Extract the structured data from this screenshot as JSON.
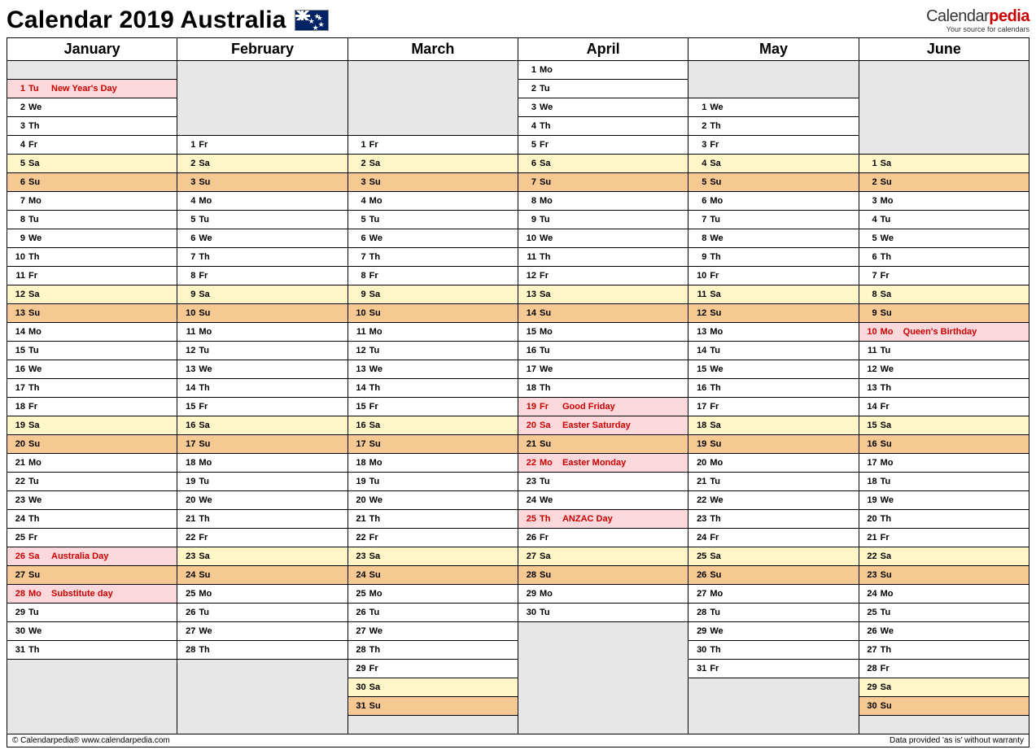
{
  "title": "Calendar 2019 Australia",
  "brand": {
    "p1": "Calendar",
    "p2": "pedia",
    "tagline": "Your source for calendars"
  },
  "footer": {
    "left": "© Calendarpedia®   www.calendarpedia.com",
    "right": "Data provided 'as is' without warranty"
  },
  "months": [
    "January",
    "February",
    "March",
    "April",
    "May",
    "June"
  ],
  "rows": 37,
  "columns": [
    {
      "offset": 1,
      "days": [
        {
          "n": 1,
          "w": "Tu",
          "h": "New Year's Day"
        },
        {
          "n": 2,
          "w": "We"
        },
        {
          "n": 3,
          "w": "Th"
        },
        {
          "n": 4,
          "w": "Fr"
        },
        {
          "n": 5,
          "w": "Sa"
        },
        {
          "n": 6,
          "w": "Su"
        },
        {
          "n": 7,
          "w": "Mo"
        },
        {
          "n": 8,
          "w": "Tu"
        },
        {
          "n": 9,
          "w": "We"
        },
        {
          "n": 10,
          "w": "Th"
        },
        {
          "n": 11,
          "w": "Fr"
        },
        {
          "n": 12,
          "w": "Sa"
        },
        {
          "n": 13,
          "w": "Su"
        },
        {
          "n": 14,
          "w": "Mo"
        },
        {
          "n": 15,
          "w": "Tu"
        },
        {
          "n": 16,
          "w": "We"
        },
        {
          "n": 17,
          "w": "Th"
        },
        {
          "n": 18,
          "w": "Fr"
        },
        {
          "n": 19,
          "w": "Sa"
        },
        {
          "n": 20,
          "w": "Su"
        },
        {
          "n": 21,
          "w": "Mo"
        },
        {
          "n": 22,
          "w": "Tu"
        },
        {
          "n": 23,
          "w": "We"
        },
        {
          "n": 24,
          "w": "Th"
        },
        {
          "n": 25,
          "w": "Fr"
        },
        {
          "n": 26,
          "w": "Sa",
          "h": "Australia Day"
        },
        {
          "n": 27,
          "w": "Su"
        },
        {
          "n": 28,
          "w": "Mo",
          "h": "Substitute day"
        },
        {
          "n": 29,
          "w": "Tu"
        },
        {
          "n": 30,
          "w": "We"
        },
        {
          "n": 31,
          "w": "Th"
        }
      ]
    },
    {
      "offset": 4,
      "days": [
        {
          "n": 1,
          "w": "Fr"
        },
        {
          "n": 2,
          "w": "Sa"
        },
        {
          "n": 3,
          "w": "Su"
        },
        {
          "n": 4,
          "w": "Mo"
        },
        {
          "n": 5,
          "w": "Tu"
        },
        {
          "n": 6,
          "w": "We"
        },
        {
          "n": 7,
          "w": "Th"
        },
        {
          "n": 8,
          "w": "Fr"
        },
        {
          "n": 9,
          "w": "Sa"
        },
        {
          "n": 10,
          "w": "Su"
        },
        {
          "n": 11,
          "w": "Mo"
        },
        {
          "n": 12,
          "w": "Tu"
        },
        {
          "n": 13,
          "w": "We"
        },
        {
          "n": 14,
          "w": "Th"
        },
        {
          "n": 15,
          "w": "Fr"
        },
        {
          "n": 16,
          "w": "Sa"
        },
        {
          "n": 17,
          "w": "Su"
        },
        {
          "n": 18,
          "w": "Mo"
        },
        {
          "n": 19,
          "w": "Tu"
        },
        {
          "n": 20,
          "w": "We"
        },
        {
          "n": 21,
          "w": "Th"
        },
        {
          "n": 22,
          "w": "Fr"
        },
        {
          "n": 23,
          "w": "Sa"
        },
        {
          "n": 24,
          "w": "Su"
        },
        {
          "n": 25,
          "w": "Mo"
        },
        {
          "n": 26,
          "w": "Tu"
        },
        {
          "n": 27,
          "w": "We"
        },
        {
          "n": 28,
          "w": "Th"
        }
      ]
    },
    {
      "offset": 4,
      "days": [
        {
          "n": 1,
          "w": "Fr"
        },
        {
          "n": 2,
          "w": "Sa"
        },
        {
          "n": 3,
          "w": "Su"
        },
        {
          "n": 4,
          "w": "Mo"
        },
        {
          "n": 5,
          "w": "Tu"
        },
        {
          "n": 6,
          "w": "We"
        },
        {
          "n": 7,
          "w": "Th"
        },
        {
          "n": 8,
          "w": "Fr"
        },
        {
          "n": 9,
          "w": "Sa"
        },
        {
          "n": 10,
          "w": "Su"
        },
        {
          "n": 11,
          "w": "Mo"
        },
        {
          "n": 12,
          "w": "Tu"
        },
        {
          "n": 13,
          "w": "We"
        },
        {
          "n": 14,
          "w": "Th"
        },
        {
          "n": 15,
          "w": "Fr"
        },
        {
          "n": 16,
          "w": "Sa"
        },
        {
          "n": 17,
          "w": "Su"
        },
        {
          "n": 18,
          "w": "Mo"
        },
        {
          "n": 19,
          "w": "Tu"
        },
        {
          "n": 20,
          "w": "We"
        },
        {
          "n": 21,
          "w": "Th"
        },
        {
          "n": 22,
          "w": "Fr"
        },
        {
          "n": 23,
          "w": "Sa"
        },
        {
          "n": 24,
          "w": "Su"
        },
        {
          "n": 25,
          "w": "Mo"
        },
        {
          "n": 26,
          "w": "Tu"
        },
        {
          "n": 27,
          "w": "We"
        },
        {
          "n": 28,
          "w": "Th"
        },
        {
          "n": 29,
          "w": "Fr"
        },
        {
          "n": 30,
          "w": "Sa"
        },
        {
          "n": 31,
          "w": "Su"
        }
      ]
    },
    {
      "offset": 0,
      "days": [
        {
          "n": 1,
          "w": "Mo"
        },
        {
          "n": 2,
          "w": "Tu"
        },
        {
          "n": 3,
          "w": "We"
        },
        {
          "n": 4,
          "w": "Th"
        },
        {
          "n": 5,
          "w": "Fr"
        },
        {
          "n": 6,
          "w": "Sa"
        },
        {
          "n": 7,
          "w": "Su"
        },
        {
          "n": 8,
          "w": "Mo"
        },
        {
          "n": 9,
          "w": "Tu"
        },
        {
          "n": 10,
          "w": "We"
        },
        {
          "n": 11,
          "w": "Th"
        },
        {
          "n": 12,
          "w": "Fr"
        },
        {
          "n": 13,
          "w": "Sa"
        },
        {
          "n": 14,
          "w": "Su"
        },
        {
          "n": 15,
          "w": "Mo"
        },
        {
          "n": 16,
          "w": "Tu"
        },
        {
          "n": 17,
          "w": "We"
        },
        {
          "n": 18,
          "w": "Th"
        },
        {
          "n": 19,
          "w": "Fr",
          "h": "Good Friday"
        },
        {
          "n": 20,
          "w": "Sa",
          "h": "Easter Saturday"
        },
        {
          "n": 21,
          "w": "Su"
        },
        {
          "n": 22,
          "w": "Mo",
          "h": "Easter Monday"
        },
        {
          "n": 23,
          "w": "Tu"
        },
        {
          "n": 24,
          "w": "We"
        },
        {
          "n": 25,
          "w": "Th",
          "h": "ANZAC Day"
        },
        {
          "n": 26,
          "w": "Fr"
        },
        {
          "n": 27,
          "w": "Sa"
        },
        {
          "n": 28,
          "w": "Su"
        },
        {
          "n": 29,
          "w": "Mo"
        },
        {
          "n": 30,
          "w": "Tu"
        }
      ]
    },
    {
      "offset": 2,
      "days": [
        {
          "n": 1,
          "w": "We"
        },
        {
          "n": 2,
          "w": "Th"
        },
        {
          "n": 3,
          "w": "Fr"
        },
        {
          "n": 4,
          "w": "Sa"
        },
        {
          "n": 5,
          "w": "Su"
        },
        {
          "n": 6,
          "w": "Mo"
        },
        {
          "n": 7,
          "w": "Tu"
        },
        {
          "n": 8,
          "w": "We"
        },
        {
          "n": 9,
          "w": "Th"
        },
        {
          "n": 10,
          "w": "Fr"
        },
        {
          "n": 11,
          "w": "Sa"
        },
        {
          "n": 12,
          "w": "Su"
        },
        {
          "n": 13,
          "w": "Mo"
        },
        {
          "n": 14,
          "w": "Tu"
        },
        {
          "n": 15,
          "w": "We"
        },
        {
          "n": 16,
          "w": "Th"
        },
        {
          "n": 17,
          "w": "Fr"
        },
        {
          "n": 18,
          "w": "Sa"
        },
        {
          "n": 19,
          "w": "Su"
        },
        {
          "n": 20,
          "w": "Mo"
        },
        {
          "n": 21,
          "w": "Tu"
        },
        {
          "n": 22,
          "w": "We"
        },
        {
          "n": 23,
          "w": "Th"
        },
        {
          "n": 24,
          "w": "Fr"
        },
        {
          "n": 25,
          "w": "Sa"
        },
        {
          "n": 26,
          "w": "Su"
        },
        {
          "n": 27,
          "w": "Mo"
        },
        {
          "n": 28,
          "w": "Tu"
        },
        {
          "n": 29,
          "w": "We"
        },
        {
          "n": 30,
          "w": "Th"
        },
        {
          "n": 31,
          "w": "Fr"
        }
      ]
    },
    {
      "offset": 5,
      "days": [
        {
          "n": 1,
          "w": "Sa"
        },
        {
          "n": 2,
          "w": "Su"
        },
        {
          "n": 3,
          "w": "Mo"
        },
        {
          "n": 4,
          "w": "Tu"
        },
        {
          "n": 5,
          "w": "We"
        },
        {
          "n": 6,
          "w": "Th"
        },
        {
          "n": 7,
          "w": "Fr"
        },
        {
          "n": 8,
          "w": "Sa"
        },
        {
          "n": 9,
          "w": "Su"
        },
        {
          "n": 10,
          "w": "Mo",
          "h": "Queen's Birthday"
        },
        {
          "n": 11,
          "w": "Tu"
        },
        {
          "n": 12,
          "w": "We"
        },
        {
          "n": 13,
          "w": "Th"
        },
        {
          "n": 14,
          "w": "Fr"
        },
        {
          "n": 15,
          "w": "Sa"
        },
        {
          "n": 16,
          "w": "Su"
        },
        {
          "n": 17,
          "w": "Mo"
        },
        {
          "n": 18,
          "w": "Tu"
        },
        {
          "n": 19,
          "w": "We"
        },
        {
          "n": 20,
          "w": "Th"
        },
        {
          "n": 21,
          "w": "Fr"
        },
        {
          "n": 22,
          "w": "Sa"
        },
        {
          "n": 23,
          "w": "Su"
        },
        {
          "n": 24,
          "w": "Mo"
        },
        {
          "n": 25,
          "w": "Tu"
        },
        {
          "n": 26,
          "w": "We"
        },
        {
          "n": 27,
          "w": "Th"
        },
        {
          "n": 28,
          "w": "Fr"
        },
        {
          "n": 29,
          "w": "Sa"
        },
        {
          "n": 30,
          "w": "Su"
        }
      ]
    }
  ]
}
